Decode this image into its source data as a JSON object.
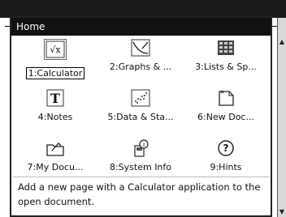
{
  "home": {
    "title": "Home",
    "apps": [
      {
        "label": "1:Calculator",
        "icon": "calculator-icon"
      },
      {
        "label": "2:Graphs & ...",
        "icon": "graphs-icon"
      },
      {
        "label": "3:Lists & Sp...",
        "icon": "lists-spreadsheet-icon"
      },
      {
        "label": "4:Notes",
        "icon": "notes-icon"
      },
      {
        "label": "5:Data & Sta...",
        "icon": "data-statistics-icon"
      },
      {
        "label": "6:New Doc...",
        "icon": "new-document-icon"
      },
      {
        "label": "7:My Docu...",
        "icon": "my-documents-icon"
      },
      {
        "label": "8:System Info",
        "icon": "system-info-icon"
      },
      {
        "label": "9:Hints",
        "icon": "hints-icon"
      }
    ],
    "selected": "1:Calculator",
    "description": "Add a new page with a Calculator application to the open document."
  }
}
